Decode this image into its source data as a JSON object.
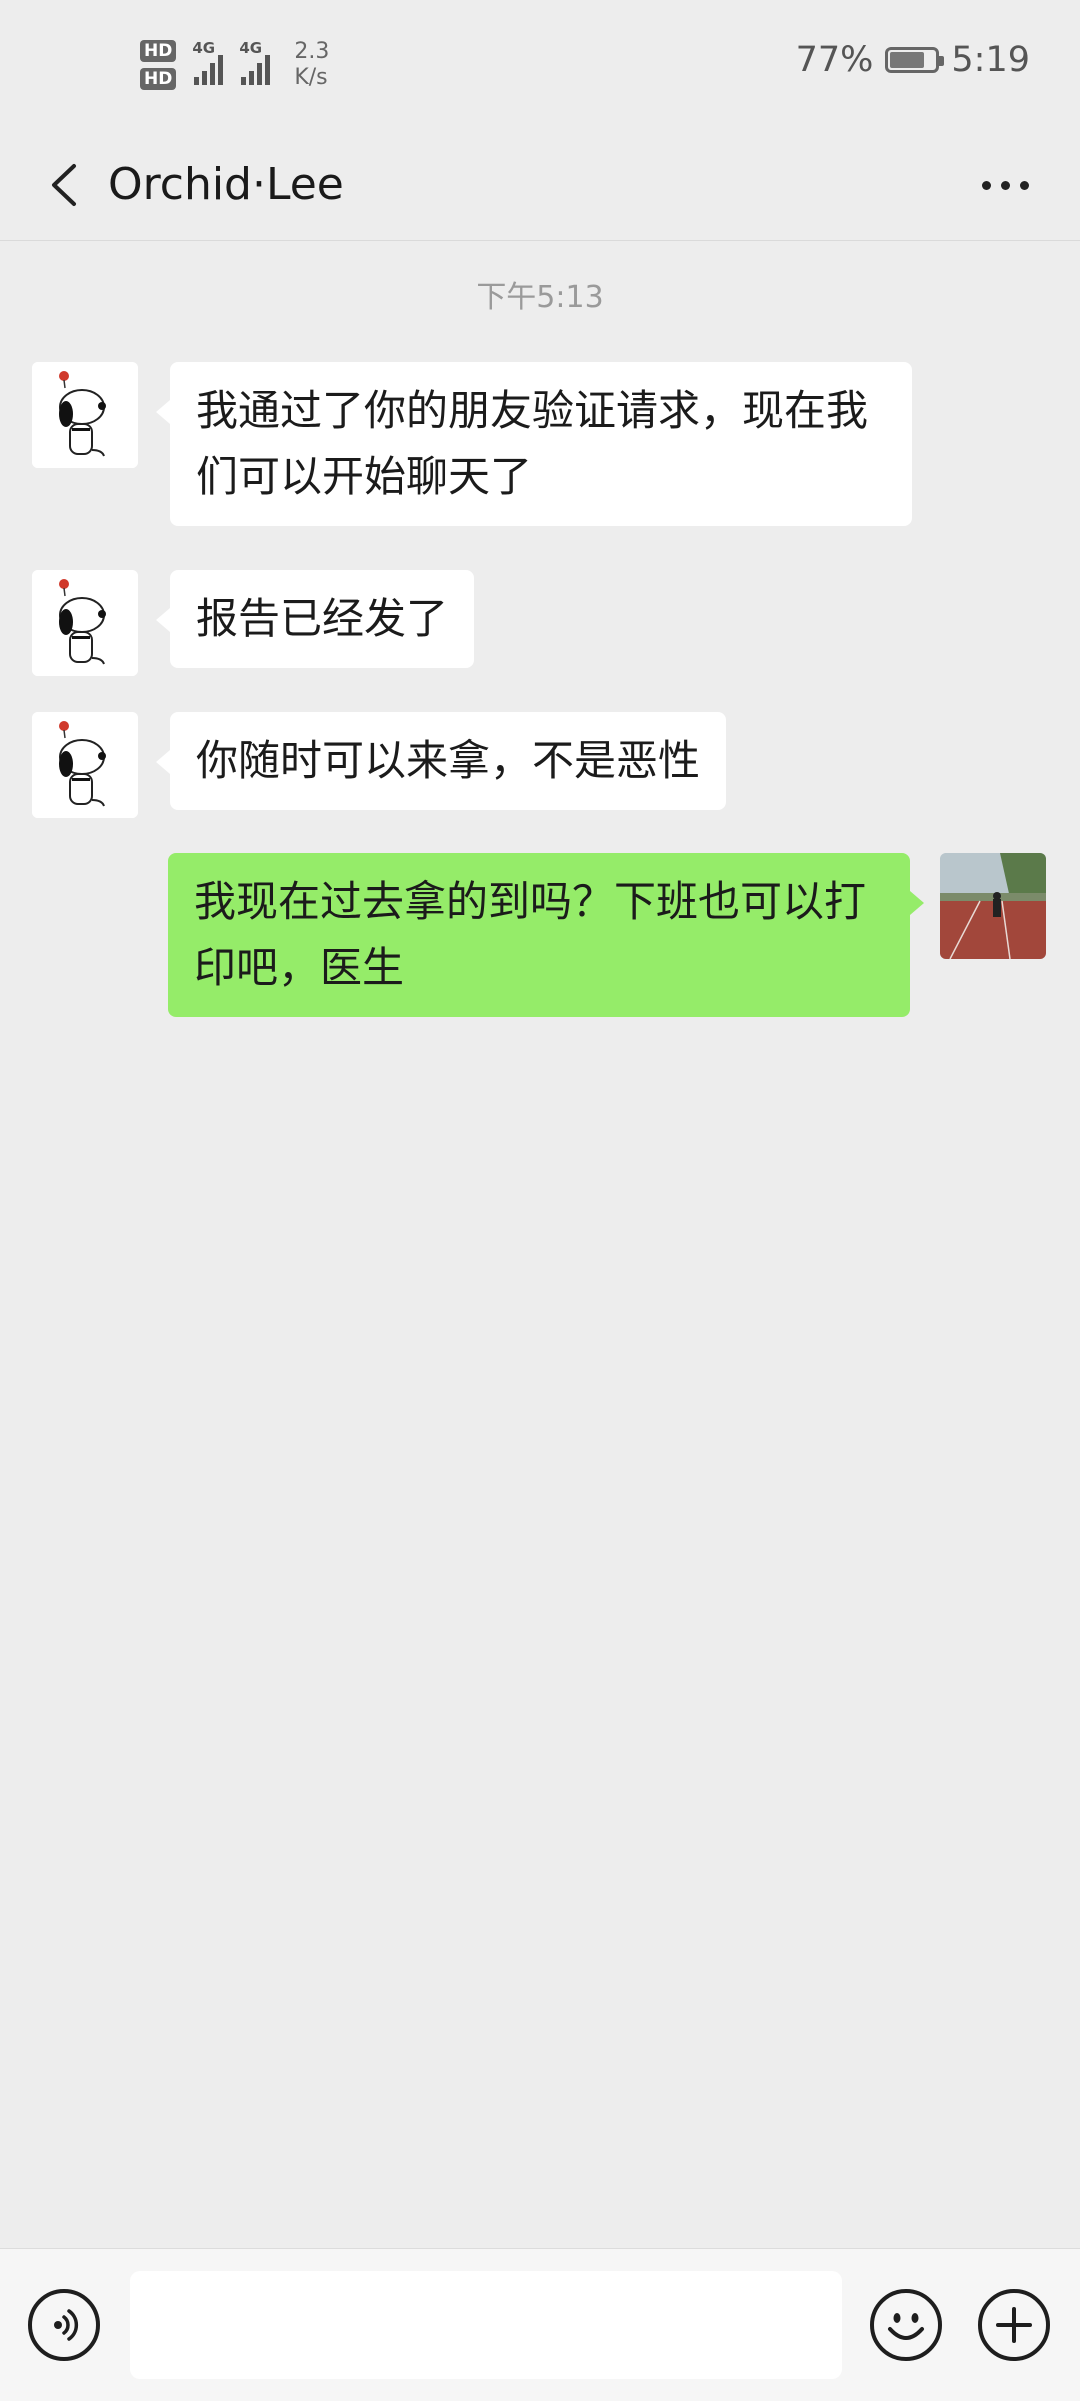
{
  "status_bar": {
    "hd1": "HD",
    "hd2": "HD",
    "net1": "4G",
    "net2": "4G",
    "speed_value": "2.3",
    "speed_unit": "K/s",
    "battery_percent": "77%",
    "time": "5:19"
  },
  "header": {
    "title": "Orchid·Lee",
    "back_icon": "chevron-left-icon",
    "more_icon": "more-dots-icon"
  },
  "chat": {
    "timestamp": "下午5:13",
    "messages": [
      {
        "from": "contact",
        "text": "我通过了你的朋友验证请求，现在我们可以开始聊天了"
      },
      {
        "from": "contact",
        "text": "报告已经发了"
      },
      {
        "from": "contact",
        "text": "你随时可以来拿，不是恶性"
      },
      {
        "from": "me",
        "text": "我现在过去拿的到吗？下班也可以打印吧，医生"
      }
    ]
  },
  "input_bar": {
    "voice_icon": "voice-icon",
    "emoji_icon": "emoji-icon",
    "plus_icon": "plus-icon",
    "input_value": ""
  },
  "colors": {
    "background": "#ededed",
    "incoming_bubble": "#ffffff",
    "outgoing_bubble": "#95ec69"
  }
}
